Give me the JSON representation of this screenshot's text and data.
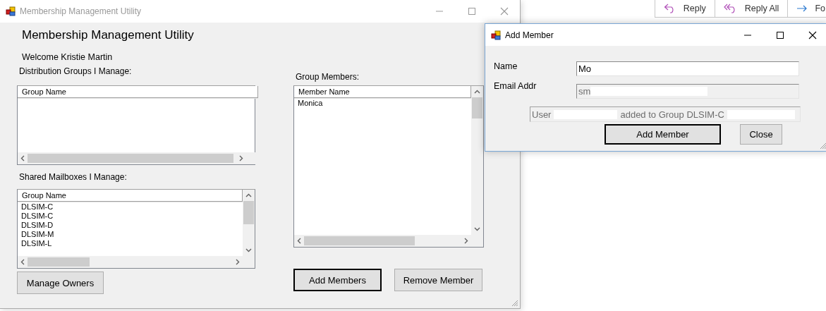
{
  "main_window": {
    "title": "Membership Management Utility",
    "heading": "Membership Management Utility",
    "welcome": "Welcome Kristie Martin",
    "distribution_groups": {
      "label": "Distribution Groups I Manage:",
      "columns": [
        "Group Name"
      ]
    },
    "shared_mailboxes": {
      "label": "Shared Mailboxes I Manage:",
      "columns": [
        "Group Name"
      ],
      "rows": [
        "DLSIM-C",
        "DLSIM-C",
        "DLSIM-D",
        "DLSIM-M",
        "DLSIM-L"
      ]
    },
    "manage_owners_button": {
      "label": "Manage Owners",
      "default": false
    },
    "group_members": {
      "label": "Group Members:",
      "columns": [
        "Member Name"
      ],
      "rows": [
        "Monica"
      ]
    },
    "buttons": [
      {
        "label": "Add Members",
        "default": true
      },
      {
        "label": "Remove Member",
        "default": false
      }
    ]
  },
  "dialog": {
    "title": "Add Member",
    "fields": [
      {
        "label": "Name",
        "value": "Mo",
        "disabled": false
      },
      {
        "label": "Email Addr",
        "value": "sm",
        "disabled": true
      }
    ],
    "status": [
      "User",
      "added to Group DLSIM-C"
    ],
    "buttons": [
      {
        "label": "Add Member",
        "default": true
      },
      {
        "label": "Close",
        "default": false
      }
    ]
  },
  "background_toolbar": [
    {
      "label": "Reply",
      "kind": "reply"
    },
    {
      "label": "Reply All",
      "kind": "reply-all"
    },
    {
      "label": "Fo",
      "kind": "forward"
    }
  ]
}
